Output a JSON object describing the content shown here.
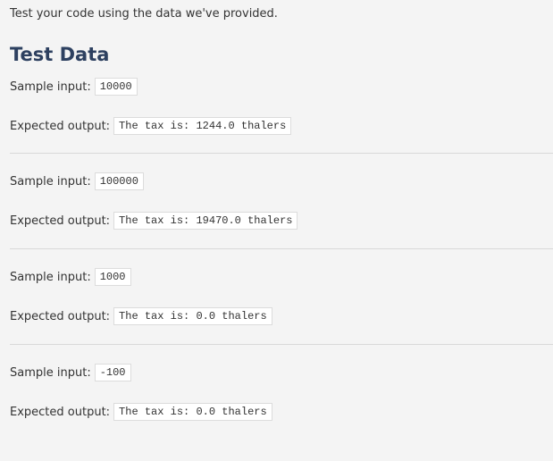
{
  "intro": "Test your code using the data we've provided.",
  "title": "Test Data",
  "labels": {
    "input": "Sample input:",
    "output": "Expected output:"
  },
  "cases": [
    {
      "input": "10000",
      "output": "The tax is: 1244.0 thalers"
    },
    {
      "input": "100000",
      "output": "The tax is: 19470.0 thalers"
    },
    {
      "input": "1000",
      "output": "The tax is: 0.0 thalers"
    },
    {
      "input": "-100",
      "output": "The tax is: 0.0 thalers"
    }
  ]
}
